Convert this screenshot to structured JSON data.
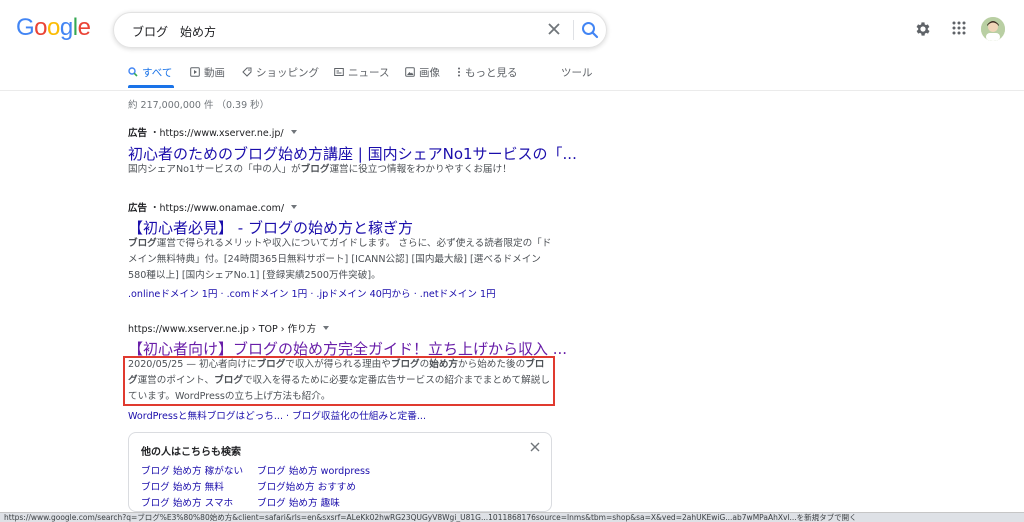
{
  "header": {
    "logo": {
      "letters": [
        "G",
        "o",
        "o",
        "g",
        "l",
        "e"
      ],
      "colors": [
        "#4285f4",
        "#ea4335",
        "#fbbc05",
        "#4285f4",
        "#34a853",
        "#ea4335"
      ]
    },
    "search": {
      "value": "ブログ　始め方",
      "placeholder": ""
    }
  },
  "tabs": [
    {
      "label": "すべて",
      "icon": "search-icon",
      "active": true
    },
    {
      "label": "動画",
      "icon": "video-icon"
    },
    {
      "label": "ショッピング",
      "icon": "tag-icon"
    },
    {
      "label": "ニュース",
      "icon": "news-icon"
    },
    {
      "label": "画像",
      "icon": "image-icon"
    },
    {
      "label": "もっと見る",
      "icon": "more-vert-icon"
    },
    {
      "label": "ツール"
    }
  ],
  "stats": "約 217,000,000 件 （0.39 秒）",
  "results": [
    {
      "ad_label": "広告",
      "url": "・https://www.xserver.ne.jp/",
      "title": "初心者のためのブログ始め方講座 | 国内シェアNo1サービスの「...",
      "snippet_html": "国内シェアNo1サービスの「中の人」が<b>ブログ</b>運営に役立つ情報をわかりやすくお届け！"
    },
    {
      "ad_label": "広告",
      "url": "・https://www.onamae.com/",
      "title": "【初心者必見】 - ブログの始め方と稼ぎ方",
      "snippet_html": "<b>ブログ</b>運営で得られるメリットや収入についてガイドします。 さらに、必ず使える読者限定の「ドメイン無料特典」付。[24時間365日無料サポート] [ICANN公認] [国内最大級] [選べるドメイン580種以上] [国内シェアNo.1] [登録実績2500万件突破]。",
      "sitelinks": [
        ".onlineドメイン 1円",
        ".comドメイン 1円",
        ".jpドメイン 40円から",
        ".netドメイン 1円"
      ]
    },
    {
      "ad_label": "",
      "url": "https://www.xserver.ne.jp › TOP › 作り方",
      "title": "【初心者向け】ブログの始め方完全ガイド！立ち上げから収入 ...",
      "snippet_html": "2020/05/25 — 初心者向けに<b>ブログ</b>で収入が得られる理由や<b>ブログ</b>の<b>始め方</b>から始めた後の<b>ブログ</b>運営のポイント、<b>ブログ</b>で収入を得るために必要な定番広告サービスの紹介までまとめて解説しています。WordPressの立ち上げ方法も紹介。",
      "sitelinks": [
        "WordPressと無料ブログはどっち...",
        "ブログ収益化の仕組みと定番..."
      ]
    }
  ],
  "related": {
    "title": "他の人はこちらも検索",
    "items": [
      "ブログ 始め方 稼がない",
      "ブログ 始め方 wordpress",
      "ブログ 始め方 無料",
      "ブログ始め方 おすすめ",
      "ブログ 始め方 スマホ",
      "ブログ 始め方 趣味"
    ]
  },
  "status_url": "https://www.google.com/search?q=ブログ%E3%80%80始め方&client=safari&rls=en&sxsrf=ALeKk02hwRG23QUGyV8Wgi_U81G...1011868176source=lnms&tbm=shop&sa=X&ved=2ahUKEwiG...ab7wMPaAhXvl...を新規タブで開く",
  "colors": {
    "accent": "#1a73e8",
    "link": "#1a0dab",
    "visited": "#681da8",
    "highlight": "#e03a2f"
  }
}
